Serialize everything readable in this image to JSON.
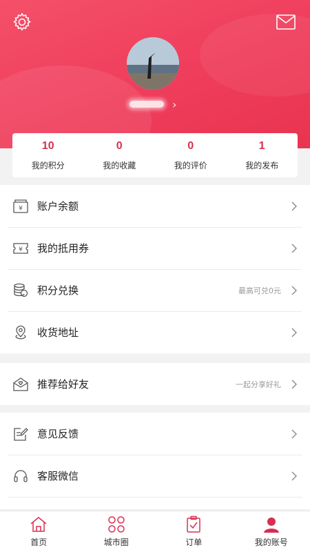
{
  "header": {
    "settings_icon": "gear-icon",
    "message_icon": "mail-icon",
    "accent_color": "#ef3d5c"
  },
  "profile": {
    "avatar_icon": "avatar"
  },
  "stats": [
    {
      "value": "10",
      "label": "我的积分"
    },
    {
      "value": "0",
      "label": "我的收藏"
    },
    {
      "value": "0",
      "label": "我的评价"
    },
    {
      "value": "1",
      "label": "我的发布"
    }
  ],
  "menu_group_1": [
    {
      "icon": "wallet-icon",
      "label": "账户余额",
      "hint": ""
    },
    {
      "icon": "coupon-icon",
      "label": "我的抵用券",
      "hint": ""
    },
    {
      "icon": "coins-icon",
      "label": "积分兑换",
      "hint": "最高可兑0元"
    },
    {
      "icon": "location-pin-icon",
      "label": "收货地址",
      "hint": ""
    }
  ],
  "menu_group_2": [
    {
      "icon": "heart-envelope-icon",
      "label": "推荐给好友",
      "hint": "一起分享好礼"
    }
  ],
  "menu_group_3": [
    {
      "icon": "edit-note-icon",
      "label": "意见反馈",
      "hint": ""
    },
    {
      "icon": "headset-icon",
      "label": "客服微信",
      "hint": ""
    }
  ],
  "tabbar": [
    {
      "icon": "home-icon",
      "label": "首页"
    },
    {
      "icon": "grid-circles-icon",
      "label": "城市圈"
    },
    {
      "icon": "clipboard-check-icon",
      "label": "订单"
    },
    {
      "icon": "user-icon",
      "label": "我的账号"
    }
  ]
}
